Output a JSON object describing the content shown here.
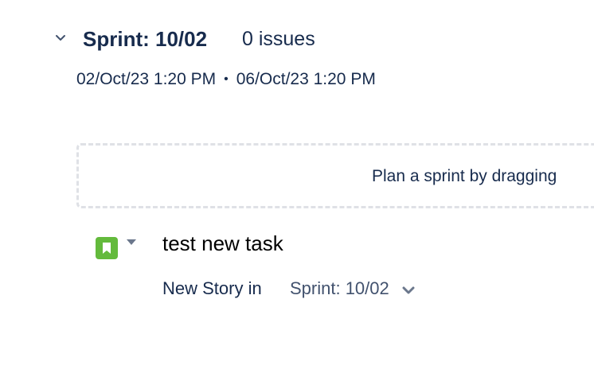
{
  "sprint": {
    "title": "Sprint: 10/02",
    "issue_count": "0 issues",
    "start_date": "02/Oct/23 1:20 PM",
    "date_separator": "•",
    "end_date": "06/Oct/23 1:20 PM"
  },
  "backlog": {
    "empty_message": "Plan a sprint by dragging"
  },
  "create_issue": {
    "issue_type_icon": "story-icon",
    "issue_type_color": "#63ba3c",
    "summary_value": "test new task",
    "destination_prefix": "New Story in",
    "destination_value": "Sprint: 10/02"
  }
}
